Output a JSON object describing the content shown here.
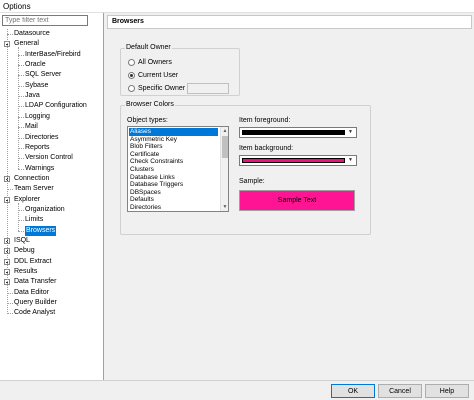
{
  "window": {
    "title": "Options"
  },
  "filter": {
    "placeholder": "Type filter text"
  },
  "tree": [
    {
      "label": "Datasource",
      "level": 0,
      "expander": "none"
    },
    {
      "label": "General",
      "level": 0,
      "expander": "minus"
    },
    {
      "label": "InterBase/Firebird",
      "level": 1,
      "expander": "none"
    },
    {
      "label": "Oracle",
      "level": 1,
      "expander": "none"
    },
    {
      "label": "SQL Server",
      "level": 1,
      "expander": "none"
    },
    {
      "label": "Sybase",
      "level": 1,
      "expander": "none"
    },
    {
      "label": "Java",
      "level": 1,
      "expander": "none"
    },
    {
      "label": "LDAP Configuration",
      "level": 1,
      "expander": "none"
    },
    {
      "label": "Logging",
      "level": 1,
      "expander": "none"
    },
    {
      "label": "Mail",
      "level": 1,
      "expander": "none"
    },
    {
      "label": "Directories",
      "level": 1,
      "expander": "none"
    },
    {
      "label": "Reports",
      "level": 1,
      "expander": "none"
    },
    {
      "label": "Version Control",
      "level": 1,
      "expander": "none"
    },
    {
      "label": "Warnings",
      "level": 1,
      "expander": "none"
    },
    {
      "label": "Connection",
      "level": 0,
      "expander": "plus"
    },
    {
      "label": "Team Server",
      "level": 0,
      "expander": "none"
    },
    {
      "label": "Explorer",
      "level": 0,
      "expander": "minus"
    },
    {
      "label": "Organization",
      "level": 1,
      "expander": "none"
    },
    {
      "label": "Limits",
      "level": 1,
      "expander": "none"
    },
    {
      "label": "Browsers",
      "level": 1,
      "expander": "none",
      "selected": true
    },
    {
      "label": "ISQL",
      "level": 0,
      "expander": "plus"
    },
    {
      "label": "Debug",
      "level": 0,
      "expander": "plus"
    },
    {
      "label": "DDL Extract",
      "level": 0,
      "expander": "plus"
    },
    {
      "label": "Results",
      "level": 0,
      "expander": "plus"
    },
    {
      "label": "Data Transfer",
      "level": 0,
      "expander": "plus"
    },
    {
      "label": "Data Editor",
      "level": 0,
      "expander": "none"
    },
    {
      "label": "Query Builder",
      "level": 0,
      "expander": "none"
    },
    {
      "label": "Code Analyst",
      "level": 0,
      "expander": "none"
    }
  ],
  "panel": {
    "header": "Browsers",
    "default_owner": {
      "title": "Default Owner",
      "options": [
        "All Owners",
        "Current User",
        "Specific Owner"
      ],
      "selected_index": 1,
      "specific_owner_value": ""
    },
    "browser_colors": {
      "title": "Browser Colors",
      "object_types_label": "Object types:",
      "object_types": [
        "Aliases",
        "Asymmetric Key",
        "Blob Filters",
        "Certificate",
        "Check Constraints",
        "Clusters",
        "Database Links",
        "Database Triggers",
        "DBSpaces",
        "Defaults",
        "Directories"
      ],
      "selected_object_index": 0,
      "foreground_label": "Item foreground:",
      "foreground_color": "#000000",
      "background_label": "Item background:",
      "background_color": "#e8137d",
      "sample_label": "Sample:",
      "sample_text": "Sample Text"
    }
  },
  "buttons": {
    "ok": "OK",
    "cancel": "Cancel",
    "help": "Help"
  },
  "colors": {
    "selection": "#0078d7",
    "sample_bg": "#ff1493"
  }
}
